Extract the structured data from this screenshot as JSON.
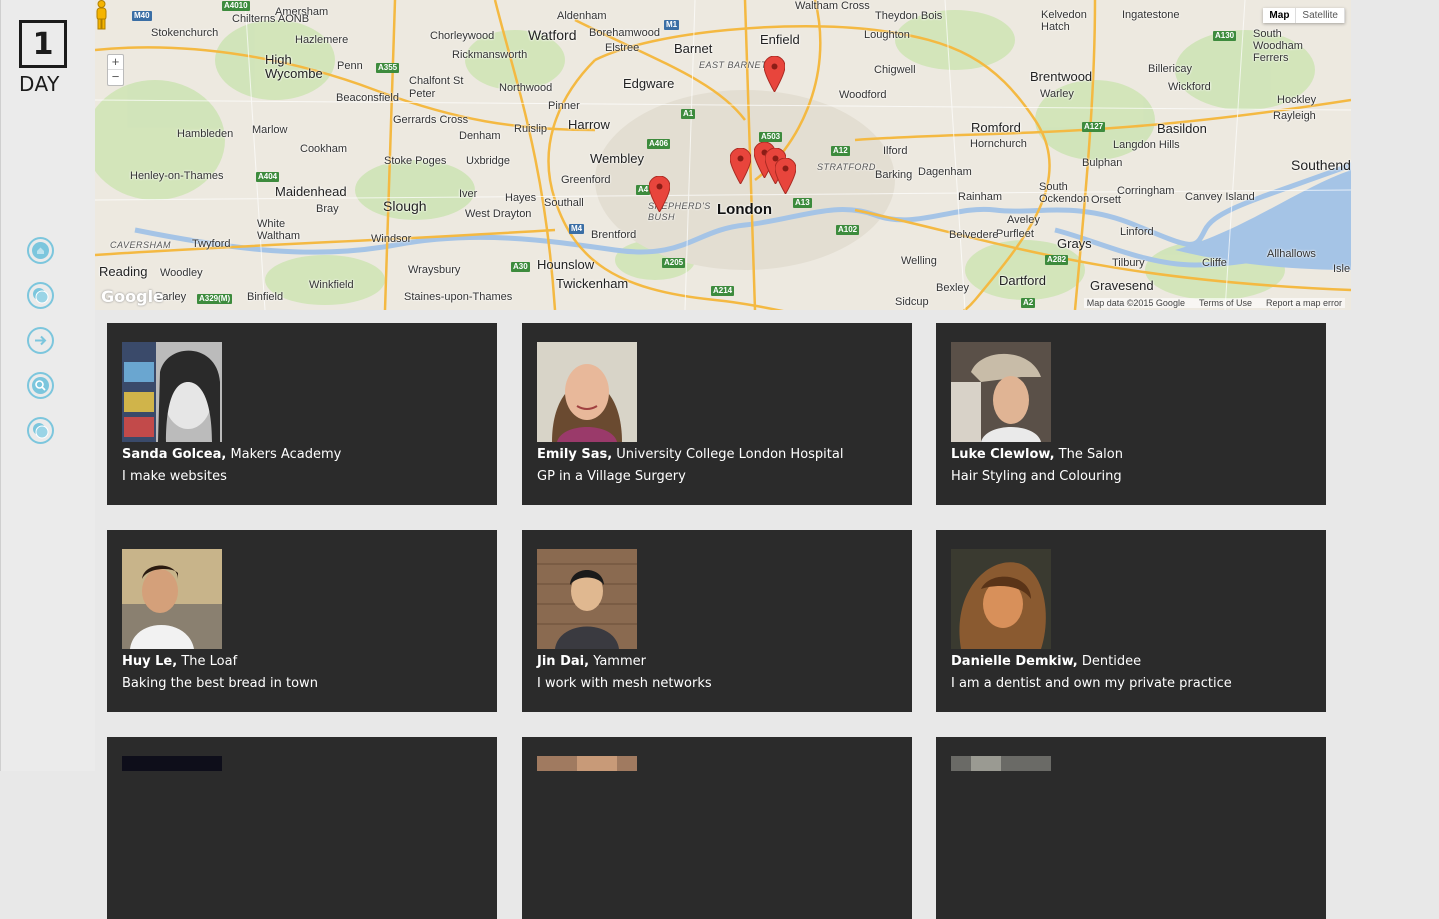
{
  "logo": {
    "number": "1",
    "word": "DAY"
  },
  "nav": [
    {
      "icon": "home-icon"
    },
    {
      "icon": "circles-icon"
    },
    {
      "icon": "arrow-right-icon"
    },
    {
      "icon": "search-icon"
    },
    {
      "icon": "circles-icon"
    }
  ],
  "map": {
    "type_buttons": [
      "Map",
      "Satellite"
    ],
    "active_type": "Map",
    "zoom_in": "+",
    "zoom_out": "−",
    "attribution": [
      "Map data ©2015 Google",
      "Terms of Use",
      "Report a map error"
    ],
    "google_logo": "Google",
    "labels": [
      "Amersham",
      "Chilterns AONB",
      "Stokenchurch",
      "Hazlemere",
      "High Wycombe",
      "Penn",
      "Beaconsfield",
      "Chalfont St Peter",
      "Gerrards Cross",
      "Marlow",
      "Hambleden",
      "Cookham",
      "Henley-on-Thames",
      "Maidenhead",
      "Bray",
      "Slough",
      "Stoke Poges",
      "Uxbridge",
      "Denham",
      "Iver",
      "White Waltham",
      "Twyford",
      "Windsor",
      "Reading",
      "Woodley",
      "Earley",
      "Winkfield",
      "Binfield",
      "Wraysbury",
      "Staines-upon-Thames",
      "CAVERSHAM",
      "Chorleywood",
      "Rickmansworth",
      "Northwood",
      "Pinner",
      "Ruislip",
      "Harrow",
      "Watford",
      "Aldenham",
      "Borehamwood",
      "Elstree",
      "Edgware",
      "Barnet",
      "EAST BARNET",
      "Enfield",
      "Waltham Cross",
      "Theydon Bois",
      "Loughton",
      "Chigwell",
      "Woodford",
      "Kelvedon Hatch",
      "Ingatestone",
      "South Woodham Ferrers",
      "Brentwood",
      "Warley",
      "Billericay",
      "Wickford",
      "Hockley",
      "Rayleigh",
      "Basildon",
      "Romford",
      "Hornchurch",
      "Langdon Hills",
      "Bulphan",
      "Southend",
      "Ilford",
      "Barking",
      "Dagenham",
      "Rainham",
      "South Ockendon",
      "Orsett",
      "Corringham",
      "Canvey Island",
      "Aveley",
      "Purfleet",
      "Grays",
      "Linford",
      "Tilbury",
      "Cliffe",
      "Allhallows",
      "Gravesend",
      "Dartford",
      "Belvedere",
      "Welling",
      "Bexley",
      "Sidcup",
      "London",
      "STRATFORD",
      "SHEPHERD'S BUSH",
      "Wembley",
      "Greenford",
      "Southall",
      "Hayes",
      "West Drayton",
      "Brentford",
      "Hounslow",
      "Twickenham",
      "Isle"
    ],
    "roads": [
      "M40",
      "A4010",
      "A355",
      "M1",
      "A1",
      "A406",
      "A503",
      "A12",
      "A13",
      "A102",
      "M4",
      "A30",
      "A205",
      "A214",
      "A127",
      "A130",
      "A282",
      "A2",
      "A404",
      "A329(M)",
      "A4"
    ]
  },
  "people": [
    {
      "name": "Sanda Golcea,",
      "company": "Makers Academy",
      "description": "I make websites"
    },
    {
      "name": "Emily Sas,",
      "company": "University College London Hospital",
      "description": "GP in a Village Surgery"
    },
    {
      "name": "Luke Clewlow,",
      "company": "The Salon",
      "description": "Hair Styling and Colouring"
    },
    {
      "name": "Huy Le,",
      "company": "The Loaf",
      "description": "Baking the best bread in town"
    },
    {
      "name": "Jin Dai,",
      "company": "Yammer",
      "description": "I work with mesh networks"
    },
    {
      "name": "Danielle Demkiw,",
      "company": "Dentidee",
      "description": "I am a dentist and own my private practice"
    }
  ]
}
